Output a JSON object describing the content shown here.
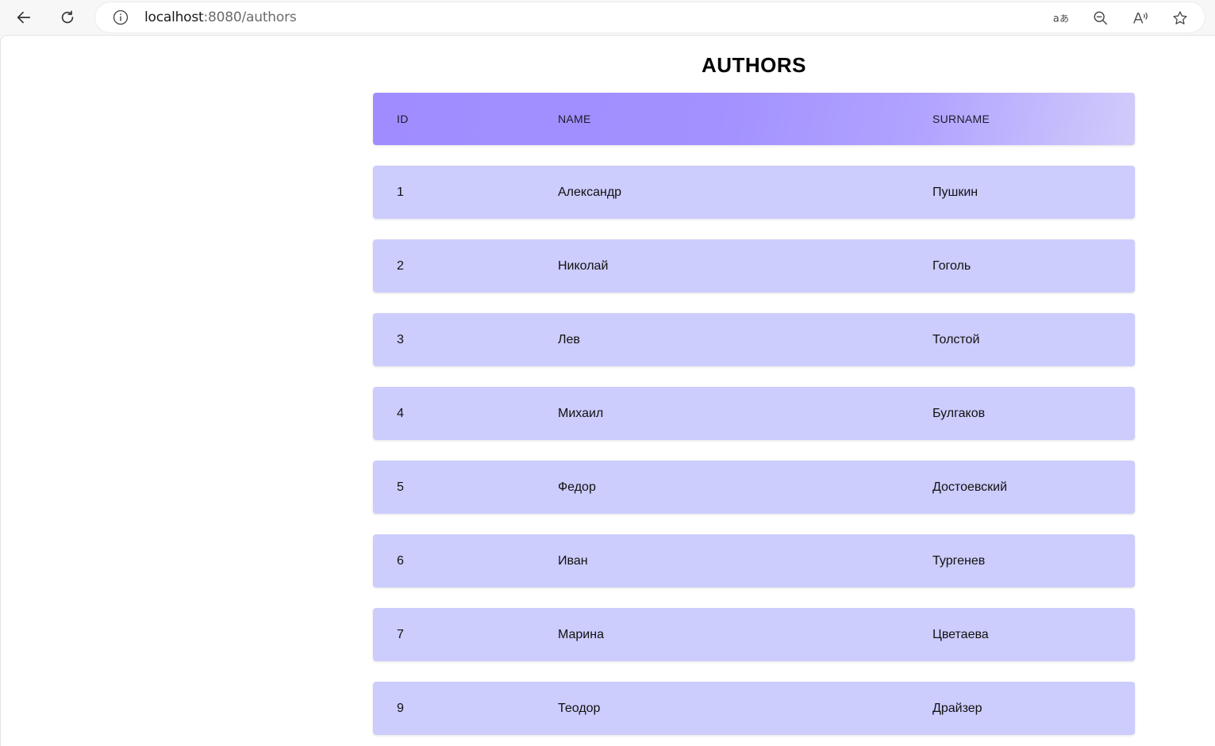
{
  "browser": {
    "url_host": "localhost",
    "url_path": ":8080/authors",
    "icons": [
      "back-arrow-icon",
      "reload-icon",
      "info-icon",
      "translate-icon",
      "zoom-out-icon",
      "read-aloud-icon",
      "favorite-star-icon"
    ]
  },
  "page": {
    "title": "AUTHORS"
  },
  "table": {
    "columns": [
      "ID",
      "NAME",
      "SURNAME"
    ],
    "rows": [
      {
        "id": "1",
        "name": "Александр",
        "surname": "Пушкин"
      },
      {
        "id": "2",
        "name": "Николай",
        "surname": "Гоголь"
      },
      {
        "id": "3",
        "name": "Лев",
        "surname": "Толстой"
      },
      {
        "id": "4",
        "name": "Михаил",
        "surname": "Булгаков"
      },
      {
        "id": "5",
        "name": "Федор",
        "surname": "Достоевский"
      },
      {
        "id": "6",
        "name": "Иван",
        "surname": "Тургенев"
      },
      {
        "id": "7",
        "name": "Марина",
        "surname": "Цветаева"
      },
      {
        "id": "9",
        "name": "Теодор",
        "surname": "Драйзер"
      }
    ]
  },
  "colors": {
    "header_gradient_start": "#a08cff",
    "header_gradient_end": "#d1cbfb",
    "row_background": "#ccccfd"
  }
}
